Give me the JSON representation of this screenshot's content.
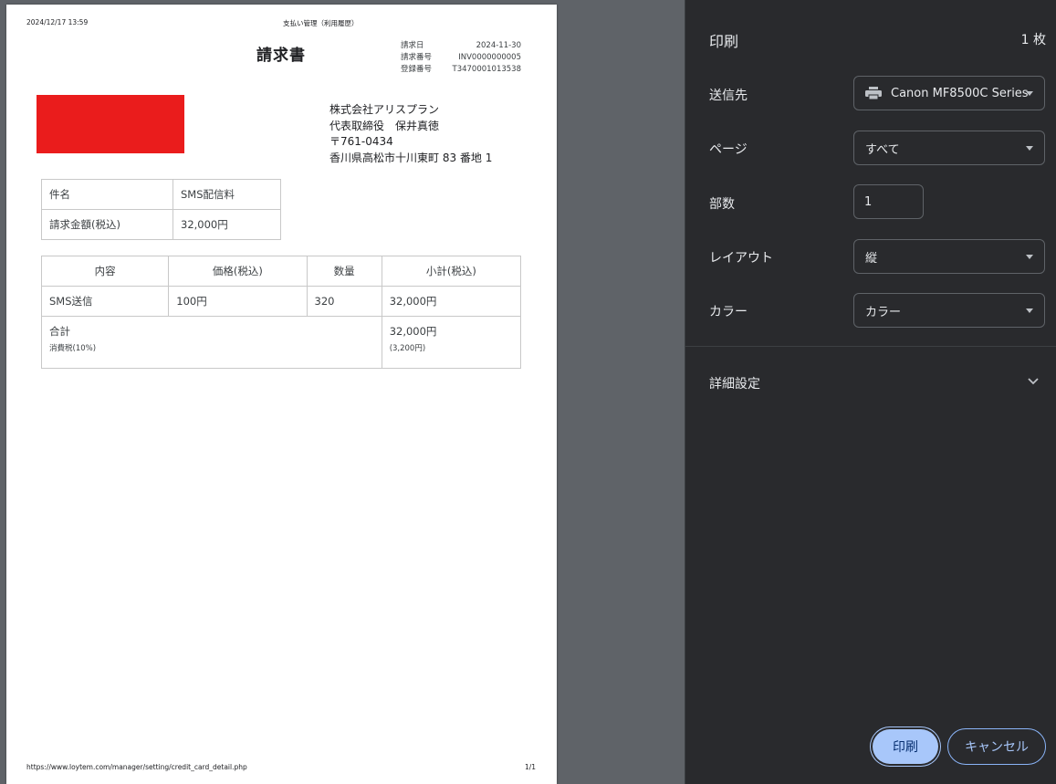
{
  "document": {
    "header_datetime": "2024/12/17 13:59",
    "header_title": "支払い管理（利用履歴）",
    "title": "請求書",
    "meta": [
      {
        "label": "請求日",
        "value": "2024-11-30"
      },
      {
        "label": "請求番号",
        "value": "INV0000000005"
      },
      {
        "label": "登録番号",
        "value": "T3470001013538"
      }
    ],
    "issuer": {
      "company": "株式会社アリスプラン",
      "representative": "代表取締役　保井真徳",
      "postal": "〒761-0434",
      "address": "香川県高松市十川東町 83 番地 1"
    },
    "summary": [
      {
        "label": "件名",
        "value": "SMS配信料"
      },
      {
        "label": "請求金額(税込)",
        "value": "32,000円"
      }
    ],
    "items_headers": [
      "内容",
      "価格(税込)",
      "数量",
      "小計(税込)"
    ],
    "items": [
      {
        "name": "SMS送信",
        "price": "100円",
        "qty": "320",
        "subtotal": "32,000円"
      }
    ],
    "total": {
      "label": "合計",
      "tax_label": "消費税(10%)",
      "value": "32,000円",
      "tax_value": "(3,200円)"
    },
    "footer_url": "https://www.loytem.com/manager/setting/credit_card_detail.php",
    "footer_page": "1/1",
    "redaction_color": "#ea1c1c"
  },
  "print_panel": {
    "title": "印刷",
    "sheet_count": "1 枚",
    "destination": {
      "label": "送信先",
      "value": "Canon MF8500C Series"
    },
    "pages": {
      "label": "ページ",
      "value": "すべて"
    },
    "copies": {
      "label": "部数",
      "value": "1"
    },
    "layout": {
      "label": "レイアウト",
      "value": "縦"
    },
    "color": {
      "label": "カラー",
      "value": "カラー"
    },
    "advanced_label": "詳細設定",
    "print_button": "印刷",
    "cancel_button": "キャンセル",
    "accent_color": "#a8c7fa"
  }
}
